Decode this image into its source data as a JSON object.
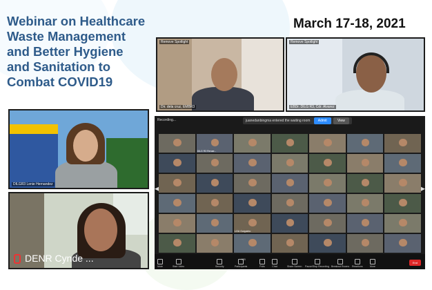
{
  "title_lines": [
    "Webinar on Healthcare",
    "Waste Management",
    "and Better Hygiene",
    "and Sanitation to",
    "Combat COVID19"
  ],
  "date": "March 17-18, 2021",
  "tiles": {
    "top_left": {
      "spotlight": "Remove Spotlight",
      "label": "Dir. dela cruz, EMBR3"
    },
    "top_right": {
      "spotlight": "Remove Spotlight",
      "label": "EBDr. DILG R3, Cdr. Alvarez"
    },
    "mid_left": {
      "label": "DILGR3 Lenie Hernandez"
    },
    "bottom_left": {
      "label": "DENR Cynde ..."
    }
  },
  "gallery": {
    "recording": "Recording...",
    "notice_text": "juanedanbingma entered the waiting room",
    "admit": "Admit",
    "view": "View",
    "cell_labels": [
      "",
      "DILG R3 Renae...",
      "",
      "",
      "",
      "",
      "",
      "",
      "",
      "",
      "",
      "",
      "",
      "",
      "",
      "",
      "",
      "",
      "",
      "",
      "",
      "",
      "",
      "",
      "",
      "",
      "",
      "",
      "",
      "",
      "LGU Guiguinto",
      "",
      "",
      "",
      "",
      "",
      "",
      "",
      "",
      "",
      "",
      ""
    ],
    "toolbar": [
      "Mute",
      "Start Video",
      "Security",
      "Participants",
      "Polls",
      "Chat",
      "Share Screen",
      "Pause/Stop Recording",
      "Breakout Rooms",
      "Reactions",
      "More"
    ],
    "participants_count": "120",
    "end": "End"
  },
  "colors": {
    "title": "#2e5b8a",
    "end": "#e02828",
    "admit": "#2d8cff"
  }
}
